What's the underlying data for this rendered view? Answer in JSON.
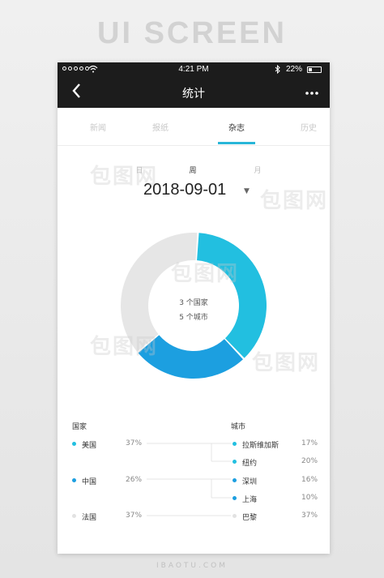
{
  "banner": "UI SCREEN",
  "status_bar": {
    "time": "4:21 PM",
    "battery": "22%"
  },
  "nav": {
    "title": "统计",
    "back_icon": "chevron-left-icon",
    "more_icon": "more-dots-icon"
  },
  "tabs": [
    {
      "label": "新闻",
      "active": false
    },
    {
      "label": "报纸",
      "active": false
    },
    {
      "label": "杂志",
      "active": true
    },
    {
      "label": "历史",
      "active": false
    }
  ],
  "period": {
    "options": [
      "日",
      "周",
      "月"
    ],
    "selected": "周"
  },
  "date": {
    "value": "2018-09-01"
  },
  "donut": {
    "center_lines": [
      "3 个国家",
      "5 个城市"
    ],
    "segments": [
      {
        "share": 37,
        "color": "#22bfe0"
      },
      {
        "share": 26,
        "color": "#1c9fe0"
      },
      {
        "share": 37,
        "color": "#e6e6e6"
      }
    ]
  },
  "country_section": {
    "label": "国家",
    "items": [
      {
        "name": "美国",
        "pct": "37%",
        "color": "#22bfe0"
      },
      {
        "name": "中国",
        "pct": "26%",
        "color": "#1c9fe0"
      },
      {
        "name": "法国",
        "pct": "37%",
        "color": "#e2e2e2"
      }
    ]
  },
  "city_section": {
    "label": "城市",
    "items": [
      {
        "name": "拉斯维加斯",
        "pct": "17%",
        "color": "#22bfe0"
      },
      {
        "name": "纽约",
        "pct": "20%",
        "color": "#22bfe0"
      },
      {
        "name": "深圳",
        "pct": "16%",
        "color": "#1c9fe0"
      },
      {
        "name": "上海",
        "pct": "10%",
        "color": "#1c9fe0"
      },
      {
        "name": "巴黎",
        "pct": "37%",
        "color": "#e2e2e2"
      }
    ]
  },
  "watermark_text": "包图网",
  "footer_watermark": "IBAOTU.COM"
}
